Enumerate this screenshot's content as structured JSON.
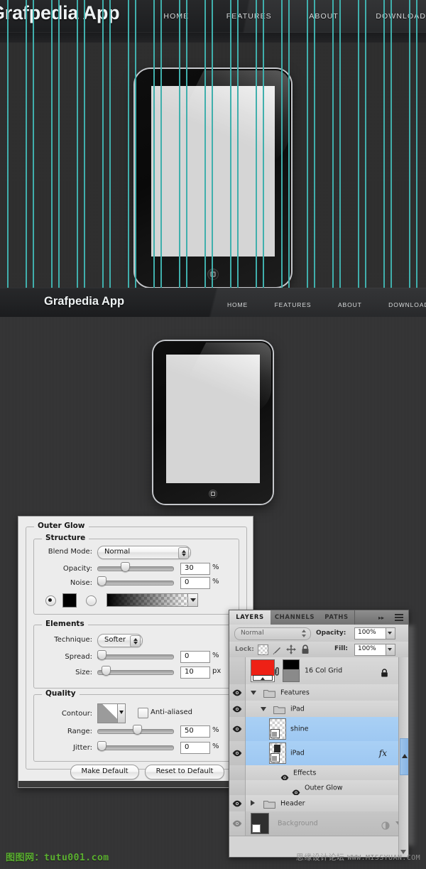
{
  "hero": {
    "title": "Grafpedia App",
    "nav": [
      "HOME",
      "FEATURES",
      "ABOUT",
      "DOWNLOAD"
    ]
  },
  "comp": {
    "title": "Grafpedia App",
    "nav": [
      "HOME",
      "FEATURES",
      "ABOUT",
      "DOWNLOAD"
    ]
  },
  "dialog": {
    "group_title": "Outer Glow",
    "structure": {
      "title": "Structure",
      "blend_mode_label": "Blend Mode:",
      "blend_mode_value": "Normal",
      "opacity_label": "Opacity:",
      "opacity_value": "30",
      "opacity_unit": "%",
      "noise_label": "Noise:",
      "noise_value": "0",
      "noise_unit": "%"
    },
    "elements": {
      "title": "Elements",
      "technique_label": "Technique:",
      "technique_value": "Softer",
      "spread_label": "Spread:",
      "spread_value": "0",
      "spread_unit": "%",
      "size_label": "Size:",
      "size_value": "10",
      "size_unit": "px"
    },
    "quality": {
      "title": "Quality",
      "contour_label": "Contour:",
      "antialiased_label": "Anti-aliased",
      "range_label": "Range:",
      "range_value": "50",
      "range_unit": "%",
      "jitter_label": "Jitter:",
      "jitter_value": "0",
      "jitter_unit": "%"
    },
    "buttons": {
      "make_default": "Make Default",
      "reset_to_default": "Reset to Default"
    }
  },
  "layers_panel": {
    "tabs": [
      "LAYERS",
      "CHANNELS",
      "PATHS"
    ],
    "blend_mode": "Normal",
    "opacity_label": "Opacity:",
    "opacity_value": "100%",
    "lock_label": "Lock:",
    "fill_label": "Fill:",
    "fill_value": "100%",
    "rows": [
      {
        "name": "16 Col Grid",
        "kind": "locked-layer"
      },
      {
        "name": "Features",
        "kind": "group-open"
      },
      {
        "name": "iPad",
        "kind": "group-open-nested"
      },
      {
        "name": "shine",
        "kind": "layer-selected"
      },
      {
        "name": "iPad",
        "kind": "layer-selected-fx"
      },
      {
        "name": "Effects",
        "kind": "effects-parent"
      },
      {
        "name": "Outer Glow",
        "kind": "effect-child"
      },
      {
        "name": "Header",
        "kind": "group-closed"
      },
      {
        "name": "Background",
        "kind": "layer-dim"
      }
    ]
  },
  "watermarks": {
    "left": "图图网：tutu001.com",
    "right_cn": "思缘设计论坛",
    "right_url": "WWW.MISSYUAN.COM"
  },
  "colors": {
    "grid_teal": "#40afac",
    "selection_blue": "#a9d0f5",
    "watermark_green": "#5bb030"
  }
}
